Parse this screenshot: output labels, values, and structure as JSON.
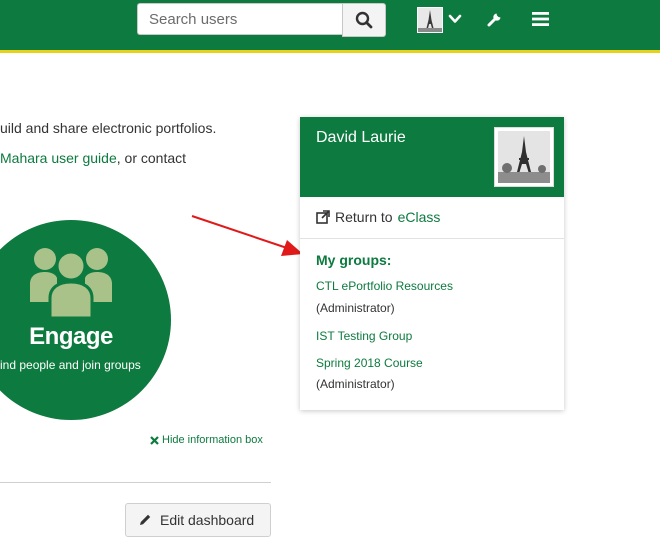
{
  "header": {
    "search_placeholder": "Search users",
    "icons": [
      "search-icon",
      "user-avatar",
      "chevron-down-icon",
      "wrench-icon",
      "menu-icon"
    ]
  },
  "intro": {
    "line1": "uild and share electronic portfolios.",
    "guide_link": "Mahara user guide",
    "line2_tail": ", or contact"
  },
  "engage": {
    "title": "Engage",
    "subtitle": "ind people and join groups"
  },
  "hide_info_label": "Hide information box",
  "edit_dashboard_label": "Edit dashboard",
  "profile_card": {
    "name": "David Laurie",
    "return_prefix": "Return to",
    "return_link": "eClass",
    "groups_title": "My groups:",
    "groups": [
      {
        "name": "CTL ePortfolio Resources",
        "role": "(Administrator)"
      },
      {
        "name": "IST Testing Group",
        "role": ""
      },
      {
        "name": "Spring 2018 Course",
        "role": "(Administrator)"
      }
    ]
  },
  "colors": {
    "brand_green": "#0d7a3f",
    "accent_yellow": "#e7d21a",
    "engage_icon": "#a8c28a",
    "arrow_red": "#e01a1a"
  }
}
